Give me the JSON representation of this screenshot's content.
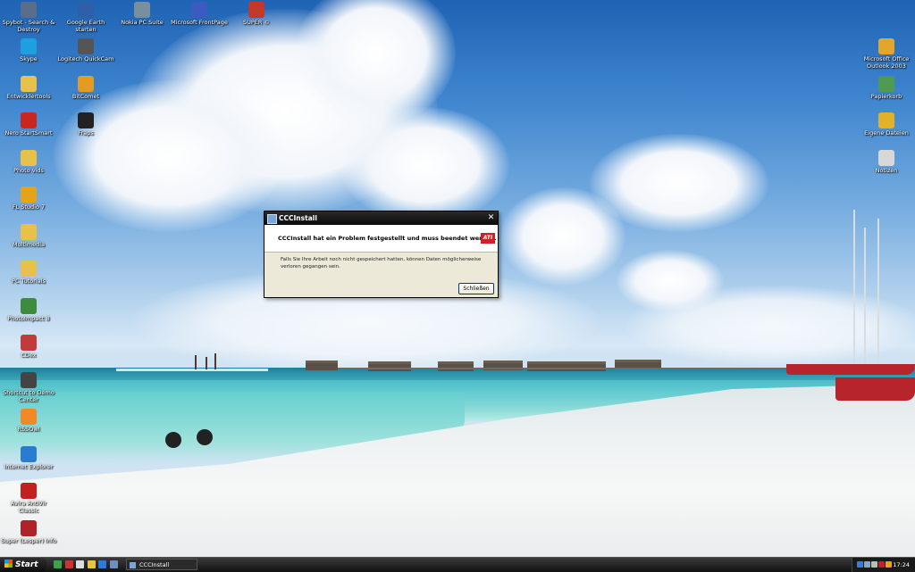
{
  "desktop_icons": [
    {
      "label": "Spybot - Search & Destroy",
      "icon": "spybot-icon",
      "color": "#5a6e8a"
    },
    {
      "label": "Google Earth starten",
      "icon": "globe-icon",
      "color": "#2f5fa8"
    },
    {
      "label": "Nokia PC Suite",
      "icon": "phone-icon",
      "color": "#7a8f9e"
    },
    {
      "label": "Microsoft FrontPage",
      "icon": "frontpage-icon",
      "color": "#3a5bbf"
    },
    {
      "label": "SUPER ©",
      "icon": "super-icon",
      "color": "#c0392b"
    },
    {
      "label": "Skype",
      "icon": "skype-icon",
      "color": "#1ea0e0"
    },
    {
      "label": "Logitech QuickCam",
      "icon": "webcam-icon",
      "color": "#555555"
    },
    {
      "label": "Entwicklertools",
      "icon": "folder-icon",
      "color": "#e8c14a"
    },
    {
      "label": "BitComet",
      "icon": "bitcomet-icon",
      "color": "#e69a1f"
    },
    {
      "label": "Nero StartSmart",
      "icon": "nero-icon",
      "color": "#c8261f"
    },
    {
      "label": "Fraps",
      "icon": "fraps-icon",
      "color": "#222222"
    },
    {
      "label": "Photo vids",
      "icon": "folder-icon",
      "color": "#e8c14a"
    },
    {
      "label": "FL Studio 7",
      "icon": "flstudio-icon",
      "color": "#e3a41c"
    },
    {
      "label": "Multimedia",
      "icon": "folder-icon",
      "color": "#e8c14a"
    },
    {
      "label": "PC Tutorials",
      "icon": "folder-icon",
      "color": "#e8c14a"
    },
    {
      "label": "PhotoImpact 8",
      "icon": "photoimpact-icon",
      "color": "#3d8b3d"
    },
    {
      "label": "CDex",
      "icon": "cdex-icon",
      "color": "#c23a3a"
    },
    {
      "label": "Shortcut to Demo Center",
      "icon": "demo-icon",
      "color": "#444444"
    },
    {
      "label": "RSSOwl",
      "icon": "rss-icon",
      "color": "#f08a24"
    },
    {
      "label": "Internet Explorer",
      "icon": "ie-icon",
      "color": "#2a7bd1"
    },
    {
      "label": "Avira AntiVir Classic",
      "icon": "avira-icon",
      "color": "#c51f1f"
    },
    {
      "label": "Super (Lesper) Info",
      "icon": "info-icon",
      "color": "#b0222a"
    },
    {
      "label": "Microsoft Office Outlook 2003",
      "icon": "outlook-icon",
      "color": "#e1a62a"
    },
    {
      "label": "Papierkorb",
      "icon": "recycle-bin-icon",
      "color": "#4f9a52"
    },
    {
      "label": "Eigene Dateien",
      "icon": "documents-icon",
      "color": "#e1b12a"
    },
    {
      "label": "Notizen",
      "icon": "notes-icon",
      "color": "#d8d8d8"
    }
  ],
  "dialog": {
    "title": "CCCInstall",
    "heading": "CCCInstall hat ein Problem festgestellt und muss beendet werden.",
    "brand": "ATI",
    "message": "Falls Sie Ihre Arbeit noch nicht gespeichert hatten, können Daten möglicherweise verloren gegangen sein.",
    "close_button": "Schließen",
    "close_glyph": "✕"
  },
  "taskbar": {
    "start_label": "Start",
    "task_label": "CCCInstall",
    "clock": "17:24",
    "quick_launch": [
      {
        "icon": "media-icon",
        "color": "#3fa14a"
      },
      {
        "icon": "app-icon",
        "color": "#cc3333"
      },
      {
        "icon": "mail-icon",
        "color": "#dddddd"
      },
      {
        "icon": "folder-icon",
        "color": "#e8c14a"
      },
      {
        "icon": "ie-icon",
        "color": "#2a7bd1"
      },
      {
        "icon": "desktop-icon",
        "color": "#6e8fb8"
      }
    ],
    "tray_icons": [
      {
        "icon": "shield-icon",
        "color": "#3a7bd5"
      },
      {
        "icon": "network-icon",
        "color": "#8da5c4"
      },
      {
        "icon": "volume-icon",
        "color": "#bbbbbb"
      },
      {
        "icon": "antivir-icon",
        "color": "#c51f1f"
      },
      {
        "icon": "security-icon",
        "color": "#e5a21f"
      }
    ]
  }
}
